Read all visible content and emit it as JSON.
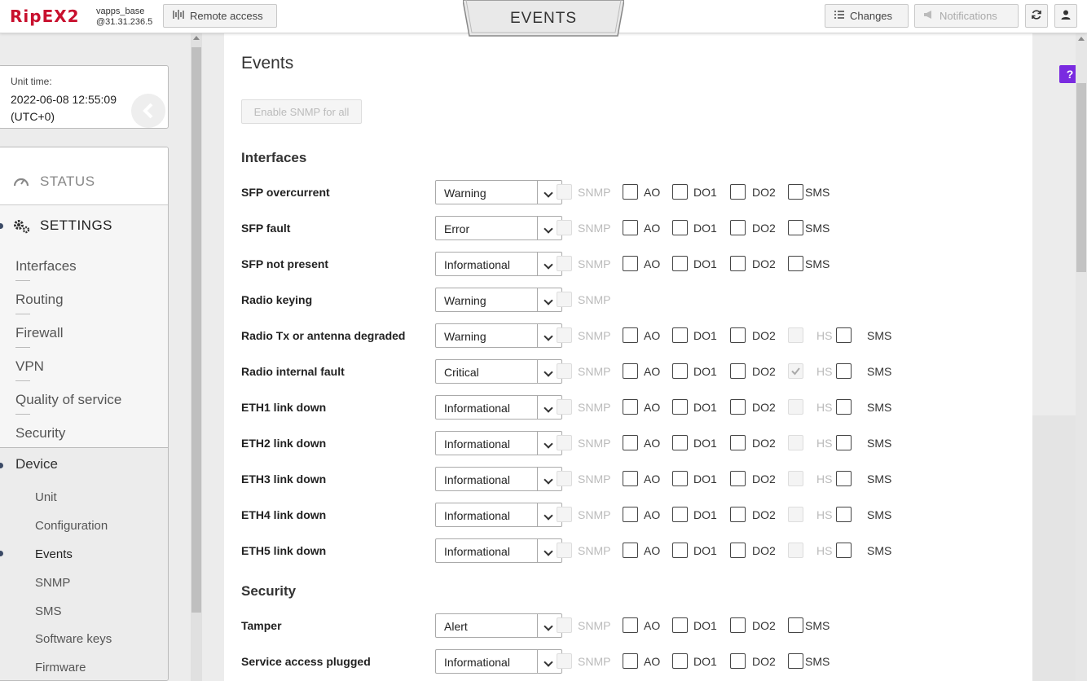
{
  "header": {
    "logo": "RipEX2",
    "unit_name": "vapps_base",
    "unit_ip": "@31.31.236.5",
    "remote_access": "Remote access",
    "page_tab": "EVENTS",
    "changes": "Changes",
    "notifications": "Notifications"
  },
  "sidebar": {
    "unit_time_label": "Unit time:",
    "unit_time_value": "2022-06-08 12:55:09 (UTC+0)",
    "status": "STATUS",
    "settings": "SETTINGS",
    "settings_items": [
      "Interfaces",
      "Routing",
      "Firewall",
      "VPN",
      "Quality of service",
      "Security"
    ],
    "device": "Device",
    "device_items": [
      "Unit",
      "Configuration",
      "Events",
      "SNMP",
      "SMS",
      "Software keys",
      "Firmware"
    ]
  },
  "main": {
    "title": "Events",
    "enable_snmp_all": "Enable SNMP for all",
    "labels": {
      "snmp": "SNMP",
      "ao": "AO",
      "do1": "DO1",
      "do2": "DO2",
      "hs": "HS",
      "sms": "SMS"
    },
    "interfaces_title": "Interfaces",
    "interfaces": [
      {
        "name": "SFP overcurrent",
        "level": "Warning"
      },
      {
        "name": "SFP fault",
        "level": "Error"
      },
      {
        "name": "SFP not present",
        "level": "Informational"
      },
      {
        "name": "Radio keying",
        "level": "Warning"
      },
      {
        "name": "Radio Tx or antenna degraded",
        "level": "Warning"
      },
      {
        "name": "Radio internal fault",
        "level": "Critical"
      },
      {
        "name": "ETH1 link down",
        "level": "Informational"
      },
      {
        "name": "ETH2 link down",
        "level": "Informational"
      },
      {
        "name": "ETH3 link down",
        "level": "Informational"
      },
      {
        "name": "ETH4 link down",
        "level": "Informational"
      },
      {
        "name": "ETH5 link down",
        "level": "Informational"
      }
    ],
    "security_title": "Security",
    "security": [
      {
        "name": "Tamper",
        "level": "Alert"
      },
      {
        "name": "Service access plugged",
        "level": "Informational"
      }
    ]
  },
  "help": "?"
}
